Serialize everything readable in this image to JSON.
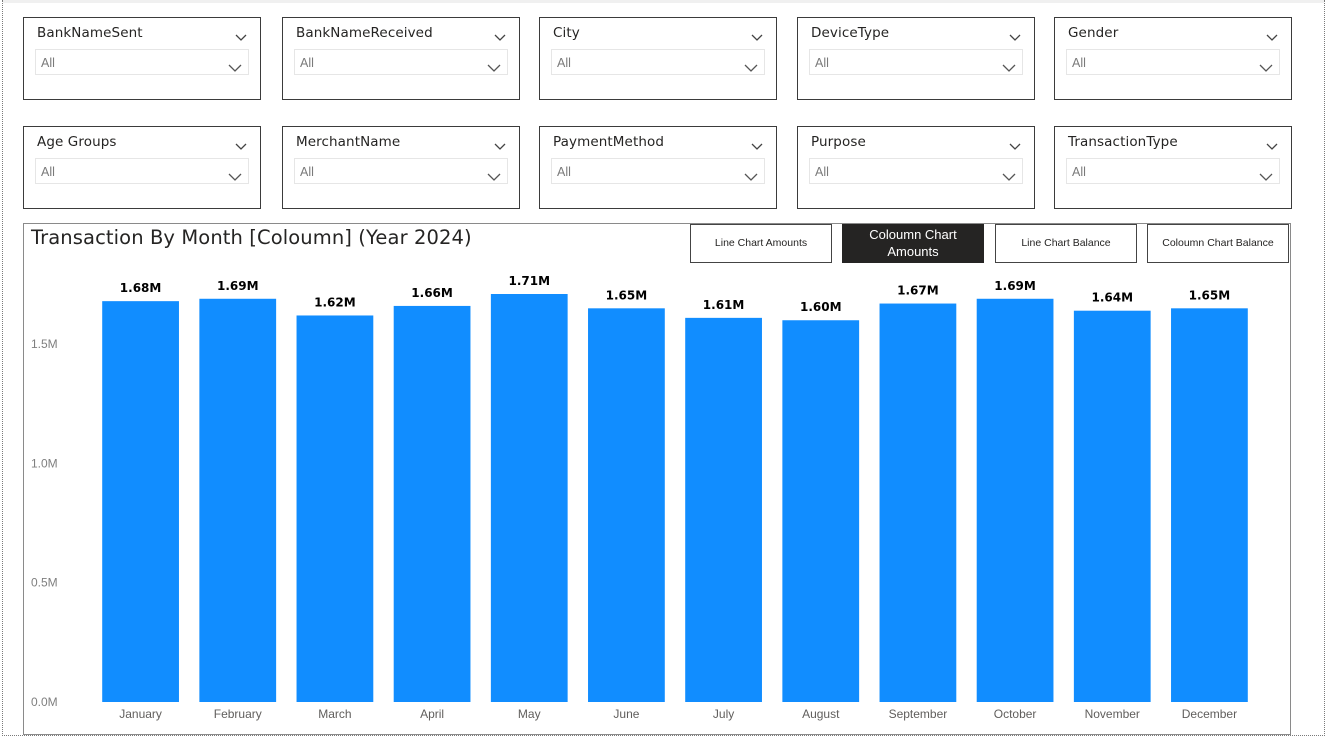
{
  "slicers": [
    {
      "title": "BankNameSent",
      "value": "All"
    },
    {
      "title": "BankNameReceived",
      "value": "All"
    },
    {
      "title": "City",
      "value": "All"
    },
    {
      "title": "DeviceType",
      "value": "All"
    },
    {
      "title": "Gender",
      "value": "All"
    },
    {
      "title": "Age Groups",
      "value": "All"
    },
    {
      "title": "MerchantName",
      "value": "All"
    },
    {
      "title": "PaymentMethod",
      "value": "All"
    },
    {
      "title": "Purpose",
      "value": "All"
    },
    {
      "title": "TransactionType",
      "value": "All"
    }
  ],
  "toggles": [
    {
      "label": "Line Chart Amounts",
      "active": false
    },
    {
      "label": "Coloumn Chart Amounts",
      "active": true
    },
    {
      "label": "Line Chart Balance",
      "active": false
    },
    {
      "label": "Coloumn Chart Balance",
      "active": false
    }
  ],
  "chart_data": {
    "type": "bar",
    "title": "Transaction By Month [Coloumn] (Year 2024)",
    "categories": [
      "January",
      "February",
      "March",
      "April",
      "May",
      "June",
      "July",
      "August",
      "September",
      "October",
      "November",
      "December"
    ],
    "values": [
      1680000,
      1690000,
      1620000,
      1660000,
      1710000,
      1650000,
      1610000,
      1600000,
      1670000,
      1690000,
      1640000,
      1650000
    ],
    "data_labels": [
      "1.68M",
      "1.69M",
      "1.62M",
      "1.66M",
      "1.71M",
      "1.65M",
      "1.61M",
      "1.60M",
      "1.67M",
      "1.69M",
      "1.64M",
      "1.65M"
    ],
    "yticks": [
      0,
      500000,
      1000000,
      1500000
    ],
    "ytick_labels": [
      "0.0M",
      "0.5M",
      "1.0M",
      "1.5M"
    ],
    "ylim": [
      0,
      1710000
    ],
    "bar_color": "#118DFF",
    "grid": false,
    "legend": "none"
  }
}
